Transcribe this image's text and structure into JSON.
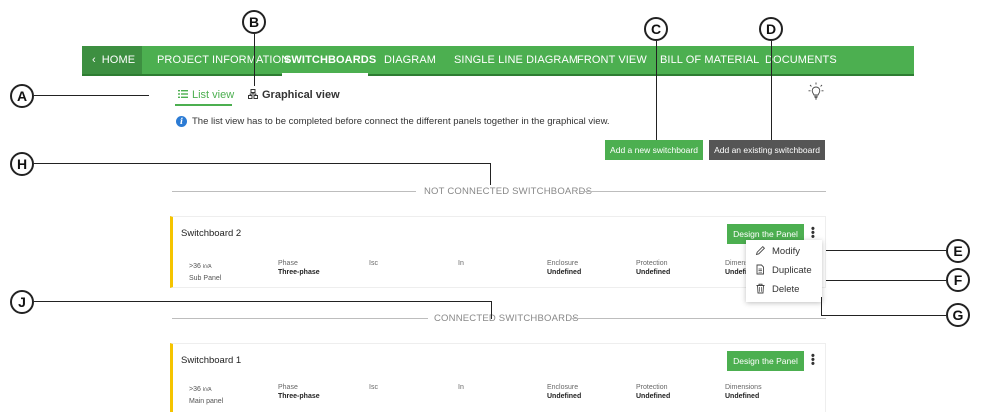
{
  "nav": {
    "home": "HOME",
    "items": [
      "PROJECT INFORMATION",
      "SWITCHBOARDS",
      "DIAGRAM",
      "SINGLE LINE DIAGRAM",
      "FRONT VIEW",
      "BILL OF MATERIAL",
      "DOCUMENTS"
    ],
    "active": "SWITCHBOARDS"
  },
  "views": {
    "list": "List view",
    "graphical": "Graphical view"
  },
  "info": "The list view has to be completed before connect the different panels together in the graphical view.",
  "buttons": {
    "add_new": "Add a new switchboard",
    "add_existing": "Add an existing switchboard"
  },
  "sections": {
    "not_connected": "NOT CONNECTED SWITCHBOARDS",
    "connected": "CONNECTED SWITCHBOARDS"
  },
  "columns": [
    "Phase",
    "Isc",
    "In",
    "Enclosure",
    "Protection",
    "Dimensions"
  ],
  "switchboards": [
    {
      "name": "Switchboard 2",
      "rating": ">36",
      "rating_unit": "kVA",
      "type": "Sub Panel",
      "phase": "Three-phase",
      "enclosure": "Undefined",
      "protection": "Undefined",
      "dimensions": "Undefi",
      "design_label": "Design the Panel"
    },
    {
      "name": "Switchboard 1",
      "rating": ">36",
      "rating_unit": "kVA",
      "type": "Main panel",
      "phase": "Three-phase",
      "enclosure": "Undefined",
      "protection": "Undefined",
      "dimensions": "Undefined",
      "design_label": "Design the Panel"
    }
  ],
  "menu": {
    "modify": "Modify",
    "duplicate": "Duplicate",
    "delete": "Delete"
  },
  "callouts": [
    "A",
    "B",
    "C",
    "D",
    "E",
    "F",
    "G",
    "H",
    "J"
  ],
  "colors": {
    "accent": "#4caf50",
    "card_border": "#f5c400",
    "dark_button": "#555555",
    "info": "#2b7bd4"
  },
  "icons": [
    "chevron-left-icon",
    "list-icon",
    "graph-icon",
    "info-icon",
    "lightbulb-icon",
    "pencil-icon",
    "duplicate-icon",
    "trash-icon",
    "kebab-icon"
  ]
}
